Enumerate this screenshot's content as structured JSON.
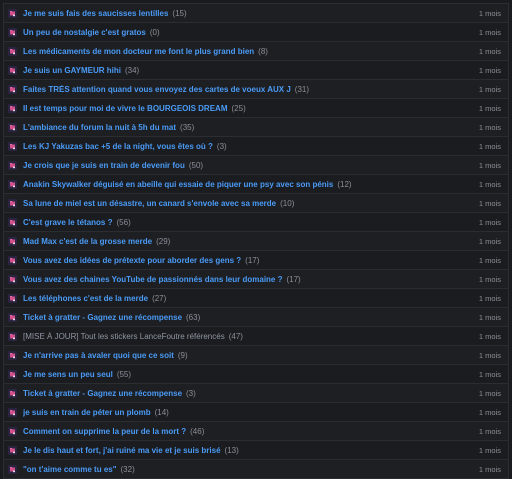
{
  "topics": [
    {
      "title": "Je me suis fais des saucisses lentilles",
      "count": "(15)",
      "date": "1 mois",
      "locked": false
    },
    {
      "title": "Un peu de nostalgie c'est gratos",
      "count": "(0)",
      "date": "1 mois",
      "locked": false
    },
    {
      "title": "Les médicaments de mon docteur me font le plus grand bien",
      "count": "(8)",
      "date": "1 mois",
      "locked": false
    },
    {
      "title": "Je suis un GAYMEUR hihi",
      "count": "(34)",
      "date": "1 mois",
      "locked": false
    },
    {
      "title": "Faites TRÈS attention quand vous envoyez des cartes de voeux AUX J",
      "count": "(31)",
      "date": "1 mois",
      "locked": false
    },
    {
      "title": "Il est temps pour moi de vivre le BOURGEOIS DREAM",
      "count": "(25)",
      "date": "1 mois",
      "locked": false
    },
    {
      "title": "L'ambiance du forum la nuit à 5h du mat",
      "count": "(35)",
      "date": "1 mois",
      "locked": false
    },
    {
      "title": "Les KJ Yakuzas bac +5 de la night, vous êtes où ?",
      "count": "(3)",
      "date": "1 mois",
      "locked": false
    },
    {
      "title": "Je crois que je suis en train de devenir fou",
      "count": "(50)",
      "date": "1 mois",
      "locked": false
    },
    {
      "title": "Anakin Skywalker déguisé en abeille qui essaie de piquer une psy avec son pénis",
      "count": "(12)",
      "date": "1 mois",
      "locked": false
    },
    {
      "title": "Sa lune de miel est un désastre, un canard s'envole avec sa merde",
      "count": "(10)",
      "date": "1 mois",
      "locked": false
    },
    {
      "title": "C'est grave le tétanos ?",
      "count": "(56)",
      "date": "1 mois",
      "locked": false
    },
    {
      "title": "Mad Max c'est de la grosse merde",
      "count": "(29)",
      "date": "1 mois",
      "locked": false
    },
    {
      "title": "Vous avez des idées de prétexte pour aborder des gens ?",
      "count": "(17)",
      "date": "1 mois",
      "locked": false
    },
    {
      "title": "Vous avez des chaines YouTube de passionnés dans leur domaine ?",
      "count": "(17)",
      "date": "1 mois",
      "locked": false
    },
    {
      "title": "Les téléphones c'est de la merde",
      "count": "(27)",
      "date": "1 mois",
      "locked": false
    },
    {
      "title": "Ticket à gratter - Gagnez une récompense",
      "count": "(63)",
      "date": "1 mois",
      "locked": false
    },
    {
      "title": "[MISE À JOUR] Tout les stickers LanceFoutre référencés",
      "count": "(47)",
      "date": "1 mois",
      "locked": true
    },
    {
      "title": "Je n'arrive pas à avaler quoi que ce soit",
      "count": "(9)",
      "date": "1 mois",
      "locked": false
    },
    {
      "title": "Je me sens un peu seul",
      "count": "(55)",
      "date": "1 mois",
      "locked": false
    },
    {
      "title": "Ticket à gratter - Gagnez une récompense",
      "count": "(3)",
      "date": "1 mois",
      "locked": false
    },
    {
      "title": "je suis en train de péter un plomb",
      "count": "(14)",
      "date": "1 mois",
      "locked": false
    },
    {
      "title": "Comment on supprime la peur de la mort ?",
      "count": "(46)",
      "date": "1 mois",
      "locked": false
    },
    {
      "title": "Je le dis haut et fort, j'ai ruiné ma vie et je suis brisé",
      "count": "(13)",
      "date": "1 mois",
      "locked": false
    },
    {
      "title": "\"on t'aime comme tu es\"",
      "count": "(32)",
      "date": "1 mois",
      "locked": false
    }
  ],
  "icon": "topic-folder-icon",
  "colors": {
    "link": "#4a9bf7",
    "locked": "#8f96a3",
    "meta": "#8a8f99",
    "background": "#1a1b1e"
  }
}
